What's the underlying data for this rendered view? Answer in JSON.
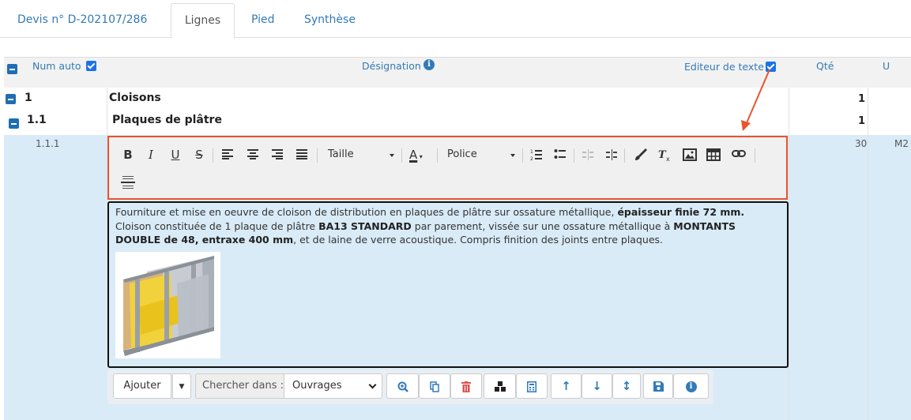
{
  "tabs": [
    {
      "label": "Devis n° D-202107/286"
    },
    {
      "label": "Lignes"
    },
    {
      "label": "Pied"
    },
    {
      "label": "Synthèse"
    }
  ],
  "header": {
    "num_auto": "Num auto",
    "designation": "Désignation",
    "editeur": "Editeur de texte",
    "qte": "Qté",
    "unit": "U"
  },
  "rows": [
    {
      "num": "1",
      "label": "Cloisons",
      "qte": "1"
    },
    {
      "num": "1.1",
      "label": "Plaques de plâtre",
      "qte": "1"
    },
    {
      "num": "1.1.1",
      "qte": "30",
      "unit": "M2"
    }
  ],
  "editor_toolbar": {
    "bold": "B",
    "italic": "I",
    "underline": "U",
    "strike": "S",
    "size_label": "Taille",
    "font_color": "A",
    "font_label": "Police"
  },
  "description": {
    "p1": "Fourniture et mise en oeuvre de cloison de distribution en plaques de plâtre sur ossature métallique, ",
    "b1": "épaisseur finie 72 mm.",
    "p2": " Cloison constituée de 1 plaque de plâtre ",
    "b2": "BA13 STANDARD",
    "p3": " par parement, vissée sur une ossature métallique à ",
    "b3": "MONTANTS DOUBLE de 48, entraxe 400 mm",
    "p4": ", et de laine de verre acoustique. Compris finition des joints entre plaques."
  },
  "bottom_toolbar": {
    "add_label": "Ajouter",
    "search_in_label": "Chercher dans :",
    "search_in_value": "Ouvrages"
  },
  "colors": {
    "accent": "#337ab7",
    "highlight_border": "#e8542f",
    "row_selected": "#d9ebf7"
  }
}
